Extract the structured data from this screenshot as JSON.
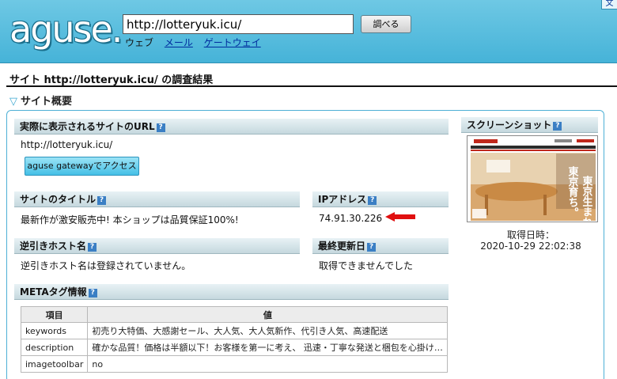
{
  "header": {
    "logo_text": "aguse.",
    "url_value": "http://lotteryuk.icu/",
    "search_button": "調べる",
    "tabs": {
      "web": "ウェブ",
      "mail": "メール",
      "gateway": "ゲートウェイ"
    },
    "corner_link": "文"
  },
  "page_title": "サイト http://lotteryuk.icu/ の調査結果",
  "section_title": "サイト概要",
  "actual_url": {
    "label": "実際に表示されるサイトのURL",
    "value": "http://lotteryuk.icu/",
    "gateway_button": "aguse gatewayでアクセス"
  },
  "site_title": {
    "label": "サイトのタイトル",
    "value": "最新作が激安販売中! 本ショップは品質保証100%!"
  },
  "ip_address": {
    "label": "IPアドレス",
    "value": "74.91.30.226"
  },
  "reverse_host": {
    "label": "逆引きホスト名",
    "value": "逆引きホスト名は登録されていません。"
  },
  "last_updated": {
    "label": "最終更新日",
    "value": "取得できませんでした"
  },
  "screenshot": {
    "label": "スクリーンショット",
    "caption_line1": "取得日時：",
    "caption_line2": "2020-10-29 22:02:38",
    "thumb_headline": "東京生まれ、東京育ち。",
    "thumb_sub": "日本製"
  },
  "meta": {
    "label": "METAタグ情報",
    "col_item": "項目",
    "col_value": "値",
    "rows": [
      {
        "key": "keywords",
        "value": "初売り大特価、大感謝セール、大人気、大人気新作、代引き人気、高速配送"
      },
      {
        "key": "description",
        "value": "確かな品質！価格は半額以下！お客様を第一に考え、 迅速・丁寧な発送と梱包を心掛けております…"
      },
      {
        "key": "imagetoolbar",
        "value": "no"
      }
    ]
  },
  "colors": {
    "header_bg": "#46b3d8",
    "link": "#002c9e",
    "arrow": "#e01010",
    "help_icon": "#3b7fc4"
  }
}
